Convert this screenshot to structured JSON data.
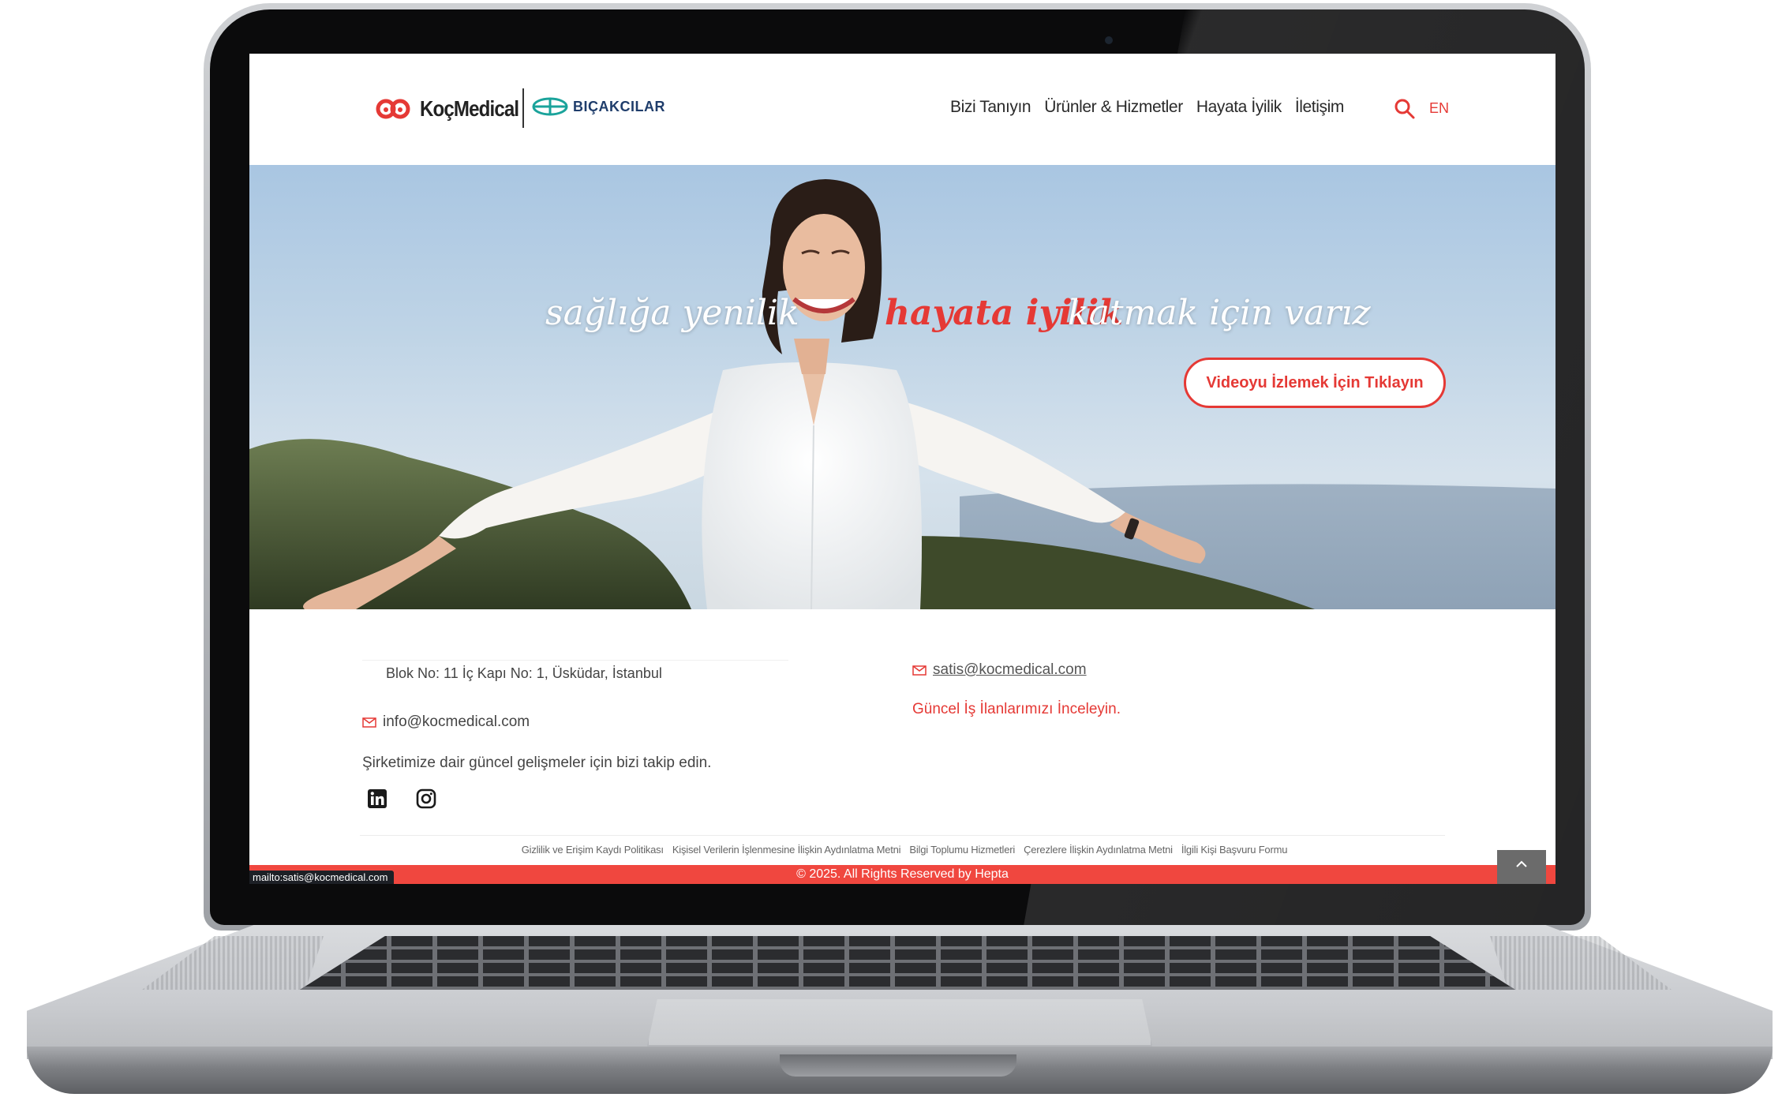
{
  "header": {
    "brand_primary": "KoçMedical",
    "brand_secondary": "BIÇAKCILAR",
    "nav": [
      {
        "label": "Bizi Tanıyın"
      },
      {
        "label": "Ürünler & Hizmetler"
      },
      {
        "label": "Hayata İyilik"
      },
      {
        "label": "İletişim"
      }
    ],
    "search_icon": "search-icon",
    "language": "EN"
  },
  "hero": {
    "tagline_part1": "sağlığa yenilik",
    "tagline_highlight": "hayata iyilik",
    "tagline_part2": "katmak için varız",
    "video_button": "Videoyu İzlemek İçin Tıklayın"
  },
  "footer": {
    "address": "Blok No: 11 İç Kapı No: 1, Üsküdar, İstanbul",
    "email_info": "info@kocmedical.com",
    "email_sales": "satis@kocmedical.com",
    "jobs_link": "Güncel İş İlanlarımızı İnceleyin.",
    "follow_text": "Şirketimize dair güncel gelişmeler için bizi takip edin.",
    "social": [
      "linkedin-icon",
      "instagram-icon"
    ],
    "legal_links": [
      "Gizlilik ve Erişim Kaydı Politikası",
      "Kişisel Verilerin İşlenmesine İlişkin Aydınlatma Metni",
      "Bilgi Toplumu Hizmetleri",
      "Çerezlere İlişkin Aydınlatma Metni",
      "İlgili Kişi Başvuru Formu"
    ],
    "copyright": "© 2025. All Rights Reserved by Hepta"
  },
  "status_bar": {
    "url": "mailto:satis@kocmedical.com"
  },
  "colors": {
    "accent": "#e53935",
    "copyright_bar": "#f0473f",
    "text": "#444444"
  }
}
